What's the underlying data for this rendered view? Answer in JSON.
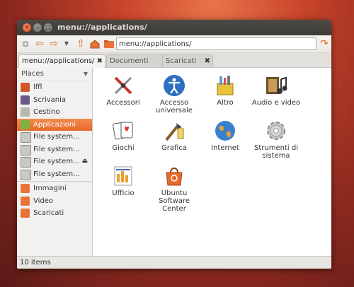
{
  "window": {
    "title": "menu://applications/"
  },
  "toolbar": {
    "location_value": "menu://applications/",
    "icons": [
      "new-window-icon",
      "back-arrow-icon",
      "forward-arrow-icon",
      "dropdown-icon",
      "up-arrow-icon",
      "home-icon",
      "go-icon"
    ]
  },
  "tabs": [
    {
      "label": "menu://applications/"
    },
    {
      "label": "Documenti"
    },
    {
      "label": "Scaricati"
    }
  ],
  "sidebar": {
    "header": "Places",
    "items": [
      {
        "label": "lffl"
      },
      {
        "label": "Scrivania"
      },
      {
        "label": "Cestino"
      },
      {
        "label": "Applicazioni"
      },
      {
        "label": "File system..."
      },
      {
        "label": "File system..."
      },
      {
        "label": "File system..."
      },
      {
        "label": "File system..."
      },
      {
        "label": "Immagini"
      },
      {
        "label": "Video"
      },
      {
        "label": "Scaricati"
      }
    ]
  },
  "apps": [
    {
      "label": "Accessori"
    },
    {
      "label": "Accesso universale"
    },
    {
      "label": "Altro"
    },
    {
      "label": "Audio e video"
    },
    {
      "label": "Giochi"
    },
    {
      "label": "Grafica"
    },
    {
      "label": "Internet"
    },
    {
      "label": "Strumenti di sistema"
    },
    {
      "label": "Ufficio"
    },
    {
      "label": "Ubuntu Software Center"
    }
  ],
  "status": {
    "text": "10 items"
  },
  "colors": {
    "accent": "#e56a2a",
    "titlebar": "#3b3a36"
  }
}
